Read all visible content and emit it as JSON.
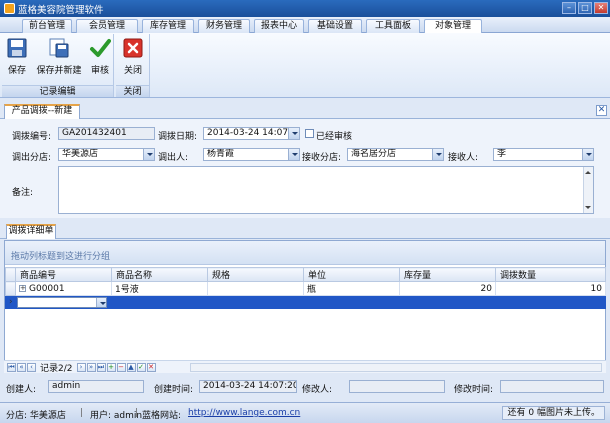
{
  "window": {
    "title": "蓝格美容院管理软件"
  },
  "menu_tabs": [
    "前台管理",
    "会员管理",
    "库存管理",
    "财务管理",
    "报表中心",
    "基础设置",
    "工具面板",
    "对象管理"
  ],
  "ribbon": {
    "save": "保存",
    "save_new": "保存并新建",
    "audit": "审核",
    "close": "关闭",
    "group_record": "记录编辑",
    "group_close": "关闭"
  },
  "doc_tab": "产品调拨--新建",
  "form": {
    "no_label": "调拨编号:",
    "no_value": "GA201432401",
    "date_label": "调拨日期:",
    "date_value": "2014-03-24 14:07",
    "audited_label": "已经审核",
    "out_store_label": "调出分店:",
    "out_store_value": "华美源店",
    "out_person_label": "调出人:",
    "out_person_value": "杨青霞",
    "in_store_label": "接收分店:",
    "in_store_value": "海名居分店",
    "receiver_label": "接收人:",
    "receiver_value": "李",
    "remark_label": "备注:",
    "remark_value": ""
  },
  "details": {
    "tab": "调拨详细单",
    "group_hint": "拖动列标题到这进行分组",
    "columns": [
      "商品编号",
      "商品名称",
      "规格",
      "单位",
      "库存量",
      "调拨数量"
    ],
    "rows": [
      {
        "code": "G00001",
        "name": "1号液",
        "spec": "",
        "unit": "瓶",
        "stock": "20",
        "qty": "10"
      }
    ],
    "record_text": "记录2/2"
  },
  "audit": {
    "creator_label": "创建人:",
    "creator_value": "admin",
    "created_label": "创建时间:",
    "created_value": "2014-03-24 14:07:20",
    "modifier_label": "修改人:",
    "modifier_value": "",
    "modified_label": "修改时间:",
    "modified_value": ""
  },
  "status": {
    "store": "分店: 华美源店",
    "user": "用户: admin",
    "site_label": "蓝格网站:",
    "site_url": "http://www.lange.com.cn",
    "upload": "还有 0 幅图片未上传。"
  }
}
